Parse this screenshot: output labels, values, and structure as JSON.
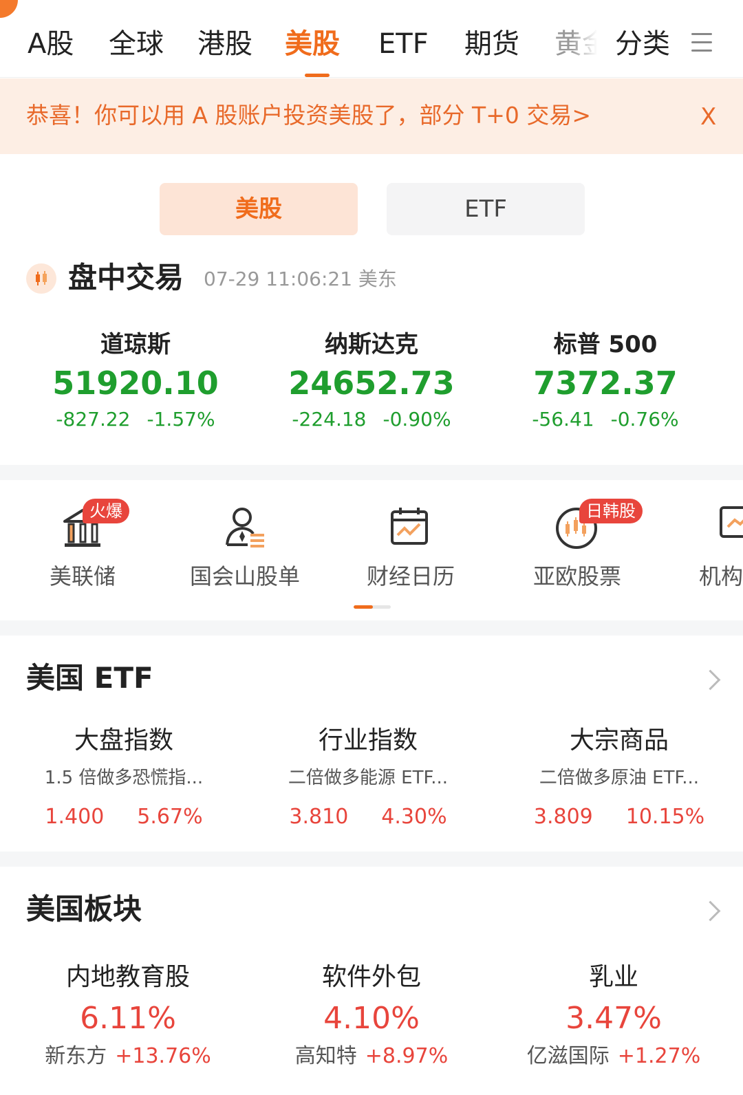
{
  "nav": {
    "tabs": [
      "A股",
      "全球",
      "港股",
      "美股",
      "ETF",
      "期货",
      "黄金"
    ],
    "active": "美股",
    "category": "分类"
  },
  "banner": {
    "text": "恭喜！你可以用 A 股账户投资美股了，部分 T+0 交易>",
    "close": "X"
  },
  "segment": {
    "stocks": "美股",
    "etf": "ETF"
  },
  "trading": {
    "title": "盘中交易",
    "time": "07-29 11:06:21 美东"
  },
  "indices": [
    {
      "name": "道琼斯",
      "value": "51920.10",
      "change": "-827.22",
      "percent": "-1.57%"
    },
    {
      "name": "纳斯达克",
      "value": "24652.73",
      "change": "-224.18",
      "percent": "-0.90%"
    },
    {
      "name": "标普 500",
      "value": "7372.37",
      "change": "-56.41",
      "percent": "-0.76%"
    }
  ],
  "shortcuts": [
    {
      "label": "美联储",
      "badge": "火爆",
      "icon": "bank-icon"
    },
    {
      "label": "国会山股单",
      "icon": "person-list-icon"
    },
    {
      "label": "财经日历",
      "icon": "calendar-chart-icon"
    },
    {
      "label": "亚欧股票",
      "badge": "日韩股",
      "icon": "globe-candles-icon"
    },
    {
      "label": "机构",
      "icon": "monitor-chart-icon"
    }
  ],
  "us_etf": {
    "title": "美国 ETF",
    "items": [
      {
        "category": "大盘指数",
        "name": "1.5 倍做多恐慌指...",
        "price": "1.400",
        "percent": "5.67%"
      },
      {
        "category": "行业指数",
        "name": "二倍做多能源 ETF...",
        "price": "3.810",
        "percent": "4.30%"
      },
      {
        "category": "大宗商品",
        "name": "二倍做多原油 ETF...",
        "price": "3.809",
        "percent": "10.15%"
      }
    ]
  },
  "us_sectors": {
    "title": "美国板块",
    "items": [
      {
        "name": "内地教育股",
        "percent": "6.11%",
        "leader": "新东方",
        "leader_change": "+13.76%"
      },
      {
        "name": "软件外包",
        "percent": "4.10%",
        "leader": "高知特",
        "leader_change": "+8.97%"
      },
      {
        "name": "乳业",
        "percent": "3.47%",
        "leader": "亿滋国际",
        "leader_change": "+1.27%"
      }
    ]
  },
  "colors": {
    "accent": "#f06c1c",
    "down": "#1f9e2e",
    "up": "#e8453c"
  }
}
